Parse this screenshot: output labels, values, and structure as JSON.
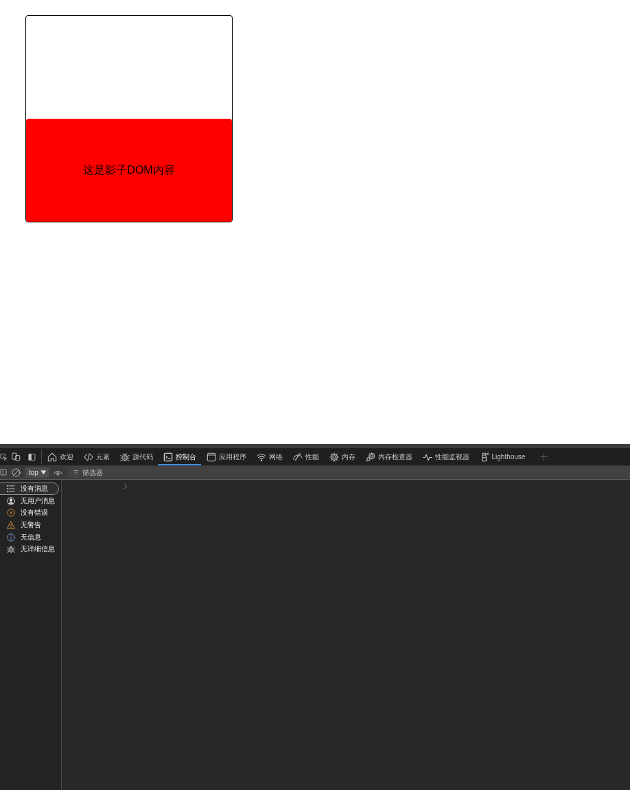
{
  "page": {
    "shadow_text": "这是影子DOM内容"
  },
  "devtools": {
    "tabs": [
      {
        "label": "欢迎",
        "selected": false
      },
      {
        "label": "元素",
        "selected": false
      },
      {
        "label": "源代码",
        "selected": false
      },
      {
        "label": "控制台",
        "selected": true
      },
      {
        "label": "应用程序",
        "selected": false
      },
      {
        "label": "网络",
        "selected": false
      },
      {
        "label": "性能",
        "selected": false
      },
      {
        "label": "内存",
        "selected": false
      },
      {
        "label": "内存检查器",
        "selected": false
      },
      {
        "label": "性能监视器",
        "selected": false
      },
      {
        "label": "Lighthouse",
        "selected": false
      }
    ],
    "console_toolbar": {
      "context": "top",
      "filter": {
        "placeholder": "筛选器"
      }
    },
    "sidebar": {
      "items": [
        {
          "label": "没有消息",
          "selected": true
        },
        {
          "label": "无用户消息",
          "selected": false
        },
        {
          "label": "没有错误",
          "selected": false
        },
        {
          "label": "无警告",
          "selected": false
        },
        {
          "label": "无信息",
          "selected": false
        },
        {
          "label": "无详细信息",
          "selected": false
        }
      ]
    }
  }
}
